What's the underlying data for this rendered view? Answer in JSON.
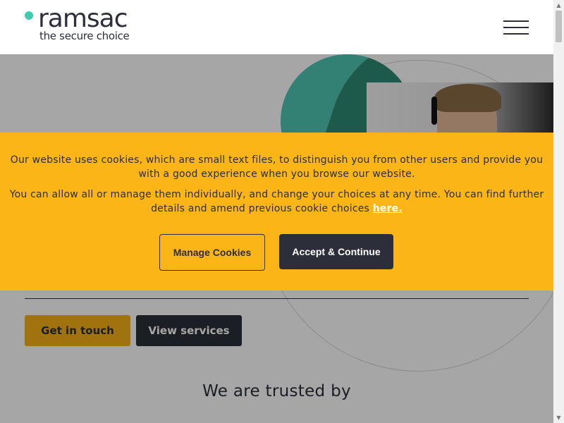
{
  "header": {
    "logo_word": "ramsac",
    "logo_tagline": "the secure choice",
    "menu_icon": "hamburger-menu-icon"
  },
  "hero": {
    "primary_button": "Get in touch",
    "secondary_button": "View services",
    "trusted_heading": "We are trusted by"
  },
  "cookie_banner": {
    "paragraph1": "Our website uses cookies, which are small text files, to distinguish you from other users and provide you with a good experience when you browse our website.",
    "paragraph2_text": "You can allow all or manage them individually, and change your choices at any time. You can find further details and amend previous cookie choices ",
    "paragraph2_link": "here.",
    "manage_button": "Manage Cookies",
    "accept_button": "Accept & Continue"
  },
  "scrollbar": {
    "up_icon": "scroll-up-arrow-icon",
    "down_icon": "scroll-down-arrow-icon"
  },
  "colors": {
    "brand_teal": "#3ccdb2",
    "brand_dark": "#2c2f3a",
    "cookie_yellow": "#fbb516",
    "button_yellow": "#f6b117"
  }
}
